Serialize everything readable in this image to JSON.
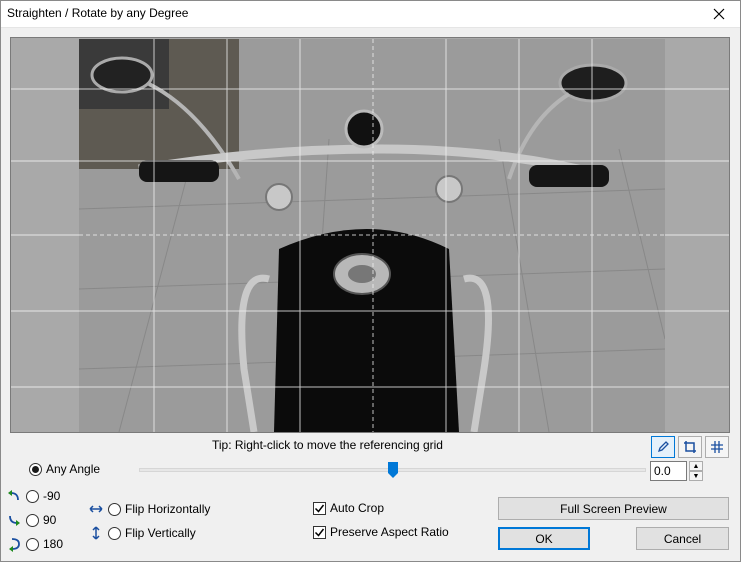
{
  "window": {
    "title": "Straighten / Rotate by any Degree",
    "close_icon": "close-icon"
  },
  "preview": {
    "tip": "Tip: Right-click to move the referencing grid",
    "photo_subject": "motorcycle-handlebars-photo"
  },
  "toolbar": {
    "pencil_icon": "pencil-icon",
    "crop_icon": "crop-icon",
    "grid_icon": "grid-icon",
    "active": "pencil"
  },
  "angle": {
    "any_angle_label": "Any Angle",
    "value": "0.0",
    "slider_fraction": 0.5
  },
  "rotations": [
    {
      "label": "-90",
      "icon": "rotate-left-icon"
    },
    {
      "label": "90",
      "icon": "rotate-right-icon"
    },
    {
      "label": "180",
      "icon": "rotate-180-icon"
    }
  ],
  "flip": {
    "horizontal_label": "Flip Horizontally",
    "vertical_label": "Flip Vertically"
  },
  "options": {
    "auto_crop_label": "Auto Crop",
    "auto_crop_checked": true,
    "preserve_label": "Preserve Aspect Ratio",
    "preserve_checked": true
  },
  "buttons": {
    "full_screen_preview": "Full Screen Preview",
    "ok": "OK",
    "cancel": "Cancel"
  },
  "colors": {
    "accent": "#0078d7",
    "icon_green": "#1e8a1e",
    "icon_blue": "#1a4fa0"
  }
}
